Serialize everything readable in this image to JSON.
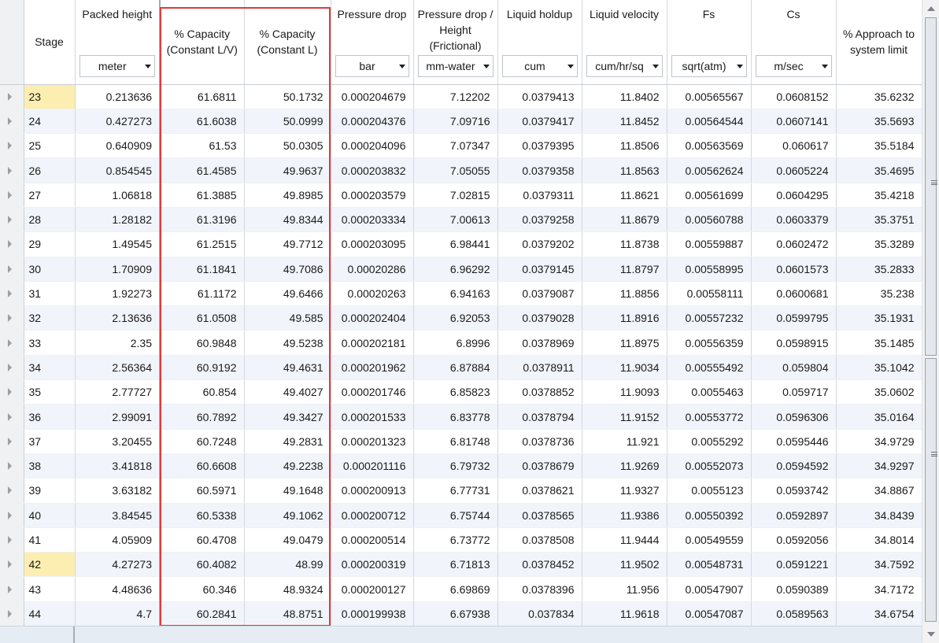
{
  "columns": {
    "stage": "Stage",
    "packed_height": {
      "title": "Packed height",
      "unit": "meter"
    },
    "capacity_lv": "% Capacity (Constant L/V)",
    "capacity_l": "% Capacity (Constant L)",
    "pressure_drop": {
      "title": "Pressure drop",
      "unit": "bar"
    },
    "pressure_drop_height": {
      "title": "Pressure drop / Height (Frictional)",
      "unit": "mm-water"
    },
    "liquid_holdup": {
      "title": "Liquid holdup",
      "unit": "cum"
    },
    "liquid_velocity": {
      "title": "Liquid velocity",
      "unit": "cum/hr/sq"
    },
    "fs": {
      "title": "Fs",
      "unit": "sqrt(atm)"
    },
    "cs": {
      "title": "Cs",
      "unit": "m/sec"
    },
    "approach": "% Approach to system limit"
  },
  "highlighted_stages": [
    "23",
    "42"
  ],
  "colors": {
    "highlight_box": "#e03b3b",
    "stage_highlight": "#fbeeb0",
    "alt_row": "#f1f5fb"
  },
  "rows": [
    [
      "23",
      "0.213636",
      "61.6811",
      "50.1732",
      "0.000204679",
      "7.12202",
      "0.0379413",
      "11.8402",
      "0.00565567",
      "0.0608152",
      "35.6232"
    ],
    [
      "24",
      "0.427273",
      "61.6038",
      "50.0999",
      "0.000204376",
      "7.09716",
      "0.0379417",
      "11.8452",
      "0.00564544",
      "0.0607141",
      "35.5693"
    ],
    [
      "25",
      "0.640909",
      "61.53",
      "50.0305",
      "0.000204096",
      "7.07347",
      "0.0379395",
      "11.8506",
      "0.00563569",
      "0.060617",
      "35.5184"
    ],
    [
      "26",
      "0.854545",
      "61.4585",
      "49.9637",
      "0.000203832",
      "7.05055",
      "0.0379358",
      "11.8563",
      "0.00562624",
      "0.0605224",
      "35.4695"
    ],
    [
      "27",
      "1.06818",
      "61.3885",
      "49.8985",
      "0.000203579",
      "7.02815",
      "0.0379311",
      "11.8621",
      "0.00561699",
      "0.0604295",
      "35.4218"
    ],
    [
      "28",
      "1.28182",
      "61.3196",
      "49.8344",
      "0.000203334",
      "7.00613",
      "0.0379258",
      "11.8679",
      "0.00560788",
      "0.0603379",
      "35.3751"
    ],
    [
      "29",
      "1.49545",
      "61.2515",
      "49.7712",
      "0.000203095",
      "6.98441",
      "0.0379202",
      "11.8738",
      "0.00559887",
      "0.0602472",
      "35.3289"
    ],
    [
      "30",
      "1.70909",
      "61.1841",
      "49.7086",
      "0.00020286",
      "6.96292",
      "0.0379145",
      "11.8797",
      "0.00558995",
      "0.0601573",
      "35.2833"
    ],
    [
      "31",
      "1.92273",
      "61.1172",
      "49.6466",
      "0.00020263",
      "6.94163",
      "0.0379087",
      "11.8856",
      "0.00558111",
      "0.0600681",
      "35.238"
    ],
    [
      "32",
      "2.13636",
      "61.0508",
      "49.585",
      "0.000202404",
      "6.92053",
      "0.0379028",
      "11.8916",
      "0.00557232",
      "0.0599795",
      "35.1931"
    ],
    [
      "33",
      "2.35",
      "60.9848",
      "49.5238",
      "0.000202181",
      "6.8996",
      "0.0378969",
      "11.8975",
      "0.00556359",
      "0.0598915",
      "35.1485"
    ],
    [
      "34",
      "2.56364",
      "60.9192",
      "49.4631",
      "0.000201962",
      "6.87884",
      "0.0378911",
      "11.9034",
      "0.00555492",
      "0.059804",
      "35.1042"
    ],
    [
      "35",
      "2.77727",
      "60.854",
      "49.4027",
      "0.000201746",
      "6.85823",
      "0.0378852",
      "11.9093",
      "0.0055463",
      "0.059717",
      "35.0602"
    ],
    [
      "36",
      "2.99091",
      "60.7892",
      "49.3427",
      "0.000201533",
      "6.83778",
      "0.0378794",
      "11.9152",
      "0.00553772",
      "0.0596306",
      "35.0164"
    ],
    [
      "37",
      "3.20455",
      "60.7248",
      "49.2831",
      "0.000201323",
      "6.81748",
      "0.0378736",
      "11.921",
      "0.0055292",
      "0.0595446",
      "34.9729"
    ],
    [
      "38",
      "3.41818",
      "60.6608",
      "49.2238",
      "0.000201116",
      "6.79732",
      "0.0378679",
      "11.9269",
      "0.00552073",
      "0.0594592",
      "34.9297"
    ],
    [
      "39",
      "3.63182",
      "60.5971",
      "49.1648",
      "0.000200913",
      "6.77731",
      "0.0378621",
      "11.9327",
      "0.0055123",
      "0.0593742",
      "34.8867"
    ],
    [
      "40",
      "3.84545",
      "60.5338",
      "49.1062",
      "0.000200712",
      "6.75744",
      "0.0378565",
      "11.9386",
      "0.00550392",
      "0.0592897",
      "34.8439"
    ],
    [
      "41",
      "4.05909",
      "60.4708",
      "49.0479",
      "0.000200514",
      "6.73772",
      "0.0378508",
      "11.9444",
      "0.00549559",
      "0.0592056",
      "34.8014"
    ],
    [
      "42",
      "4.27273",
      "60.4082",
      "48.99",
      "0.000200319",
      "6.71813",
      "0.0378452",
      "11.9502",
      "0.00548731",
      "0.0591221",
      "34.7592"
    ],
    [
      "43",
      "4.48636",
      "60.346",
      "48.9324",
      "0.000200127",
      "6.69869",
      "0.0378396",
      "11.956",
      "0.00547907",
      "0.0590389",
      "34.7172"
    ],
    [
      "44",
      "4.7",
      "60.2841",
      "48.8751",
      "0.000199938",
      "6.67938",
      "0.037834",
      "11.9618",
      "0.00547087",
      "0.0589563",
      "34.6754"
    ]
  ]
}
